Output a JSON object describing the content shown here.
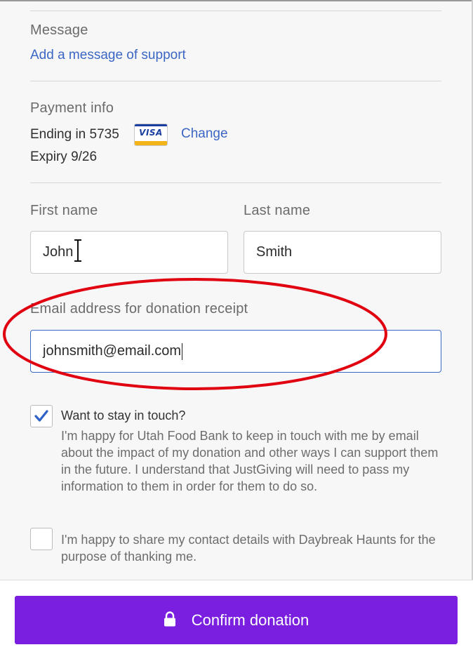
{
  "message": {
    "heading": "Message",
    "add_link": "Add a message of support"
  },
  "payment": {
    "heading": "Payment info",
    "ending": "Ending in 5735",
    "card_brand": "VISA",
    "change_link": "Change",
    "expiry": "Expiry 9/26"
  },
  "form": {
    "first_name_label": "First name",
    "first_name_value": "John",
    "last_name_label": "Last name",
    "last_name_value": "Smith",
    "email_label": "Email address for donation receipt",
    "email_value": "johnsmith@email.com"
  },
  "consent": {
    "stay_in_touch_checked": true,
    "stay_in_touch_title": "Want to stay in touch?",
    "stay_in_touch_body": "I'm happy for Utah Food Bank to keep in touch with me by email about the impact of my donation and other ways I can support them in the future. I understand that JustGiving will need to pass my information to them in order for them to do so.",
    "share_details_checked": false,
    "share_details_body": "I'm happy to share my contact details with Daybreak Haunts for the purpose of thanking me."
  },
  "footer": {
    "confirm_label": "Confirm donation"
  },
  "colors": {
    "accent_purple": "#7a1fe0",
    "link_blue": "#3b66c4",
    "annotation_red": "#e0000f"
  },
  "icons": {
    "lock": "lock-icon",
    "check": "checkmark-icon",
    "cursor": "text-cursor-icon"
  }
}
